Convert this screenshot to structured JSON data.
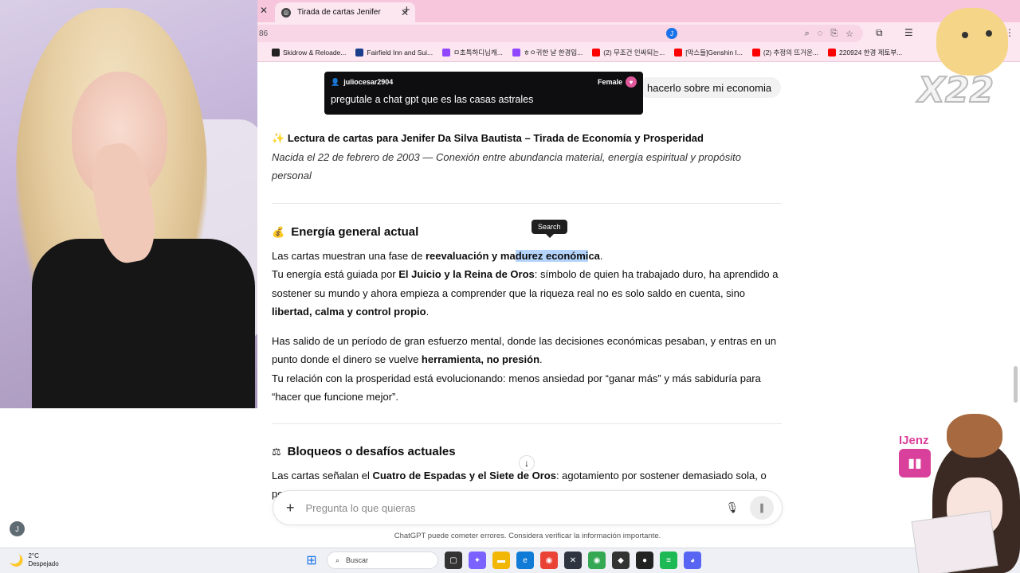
{
  "browser": {
    "tab_title": "Tirada de cartas Jenifer",
    "url_fragment": "86",
    "profile_initial": "J",
    "bookmarks": [
      {
        "label": "Skidrow & Reloade...",
        "color": "#222222"
      },
      {
        "label": "Fairfield Inn and Sui...",
        "color": "#1a3e8c"
      },
      {
        "label": "ㅁ초특하디님캐...",
        "color": "#9146ff"
      },
      {
        "label": "ㅎㅇ귀한 날 한경입...",
        "color": "#9146ff"
      },
      {
        "label": "(2) 무조건 인싸되는...",
        "color": "#ff0000"
      },
      {
        "label": "[막스들]Genshin I...",
        "color": "#ff0000"
      },
      {
        "label": "(2) 추정의 뜨거운...",
        "color": "#ff0000"
      },
      {
        "label": "220924 한경 제토부...",
        "color": "#ff0000"
      }
    ]
  },
  "chat_overlay": {
    "username": "juliocesar2904",
    "gender": "Female",
    "message": "pregutale a chat gpt que es las casas astrales"
  },
  "user_message": "hacerlo sobre mi economia",
  "reading": {
    "title": "Lectura de cartas para Jenifer Da Silva Bautista – Tirada de Economía y Prosperidad",
    "subtitle": "Nacida el 22 de febrero de 2003 — Conexión entre abundancia material, energía espiritual y propósito personal"
  },
  "section1": {
    "heading": "Energía general actual",
    "p1_a": "Las cartas muestran una fase de ",
    "p1_b": "reevaluación y ma",
    "p1_c": "durez económi",
    "p1_d": "ca",
    "p1_e": ".",
    "p2_a": "Tu energía está guiada por ",
    "p2_b": "El Juicio y la Reina de Oros",
    "p2_c": ": símbolo de quien ha trabajado duro, ha aprendido a sostener su mundo y ahora empieza a comprender que la riqueza real no es solo saldo en cuenta, sino ",
    "p2_d": "libertad, calma y control propio",
    "p2_e": ".",
    "p3_a": "Has salido de un período de gran esfuerzo mental, donde las decisiones económicas pesaban, y entras en un punto donde el dinero se vuelve ",
    "p3_b": "herramienta, no presión",
    "p3_c": ".",
    "p4": "Tu relación con la prosperidad está evolucionando: menos ansiedad por “ganar más” y más sabiduría para “hacer que funcione mejor”."
  },
  "tooltip": "Search",
  "section2": {
    "heading": "Bloqueos o desafíos actuales",
    "p1_a": "Las cartas señalan el ",
    "p1_b": "Cuatro de Espadas y el Siete de Oros",
    "p1_c": ": agotamiento por sostener demasiado sola, o por"
  },
  "composer": {
    "placeholder": "Pregunta lo que quieras"
  },
  "disclaimer": "ChatGPT puede cometer errores. Considera verificar la información importante.",
  "sidebar_avatar": "J",
  "taskbar": {
    "temp": "2°C",
    "condition": "Despejado",
    "search_label": "Buscar"
  },
  "overlay": {
    "x22": "X22",
    "brand_name": "IJenz"
  }
}
